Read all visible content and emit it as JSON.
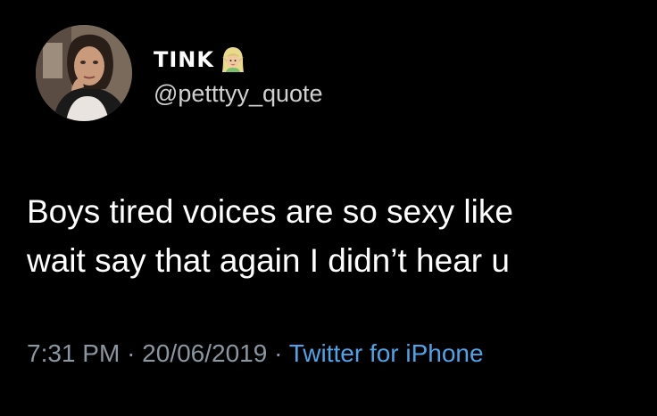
{
  "author": {
    "display_name": "TINK",
    "name_emoji_icon": "woman-elf-icon",
    "handle": "@petttyy_quote",
    "avatar_icon": "profile-photo-avatar"
  },
  "tweet": {
    "lines": [
      "Boys tired voices are so sexy like",
      "wait say that again I didn’t hear u"
    ]
  },
  "meta": {
    "time": "7:31 PM",
    "separator": "·",
    "date": "20/06/2019",
    "source": "Twitter for iPhone"
  },
  "colors": {
    "background": "#000000",
    "text": "#ffffff",
    "meta": "#8b96a0",
    "link": "#4fa3e8"
  }
}
